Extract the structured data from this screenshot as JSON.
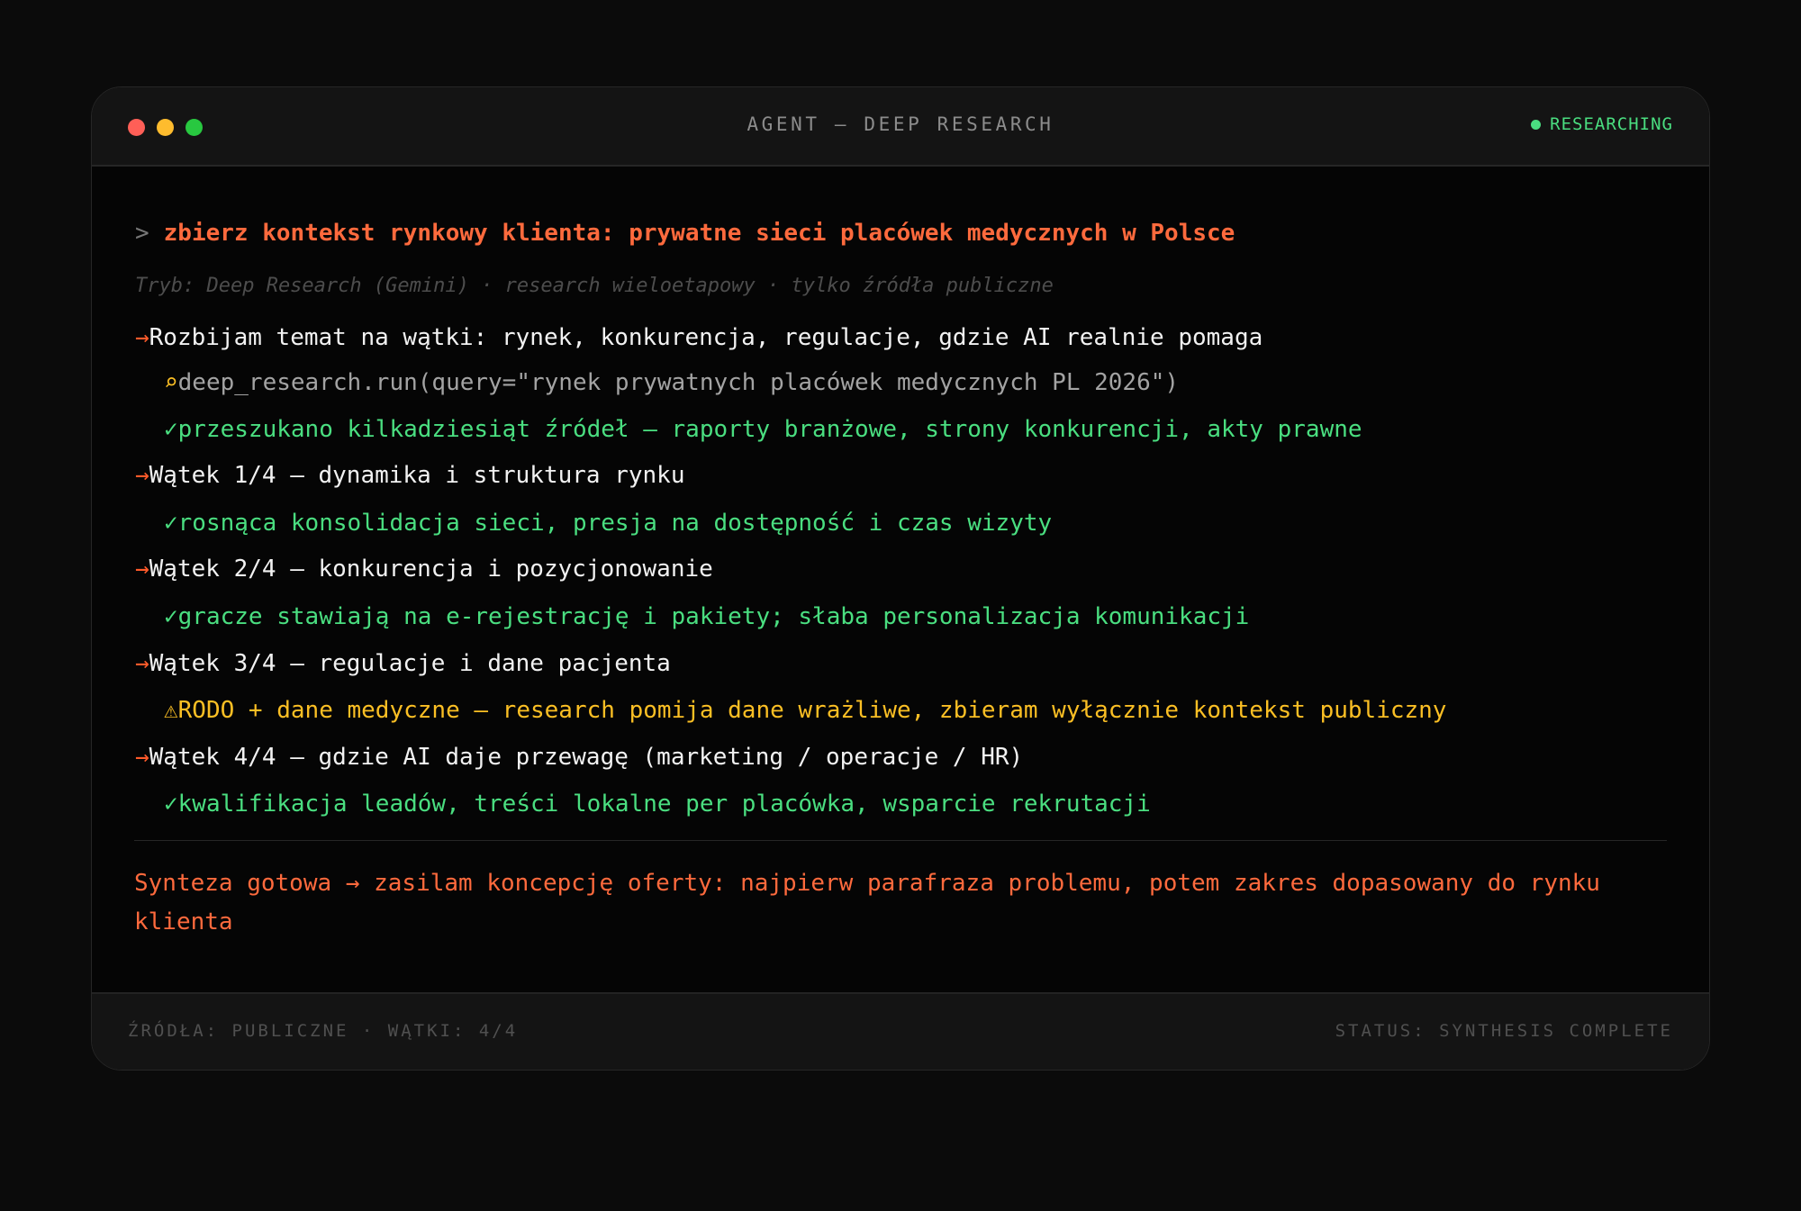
{
  "window": {
    "title": "AGENT — DEEP RESEARCH",
    "status": "RESEARCHING"
  },
  "prompt": {
    "caret": ">",
    "text": "zbierz kontekst rynkowy klienta: prywatne sieci placówek medycznych w Polsce"
  },
  "mode_line": "Tryb: Deep Research (Gemini) · research wieloetapowy · tylko źródła publiczne",
  "log": [
    {
      "kind": "step",
      "icon": "→",
      "text": "Rozbijam temat na wątki: rynek, konkurencja, regulacje, gdzie AI realnie pomaga"
    },
    {
      "kind": "tool",
      "icon": "⌕",
      "text": "deep_research.run(query=\"rynek prywatnych placówek medycznych PL 2026\")"
    },
    {
      "kind": "ok",
      "icon": "✓",
      "text": "przeszukano kilkadziesiąt źródeł — raporty branżowe, strony konkurencji, akty prawne"
    },
    {
      "kind": "step",
      "icon": "→",
      "text": "Wątek 1/4 — dynamika i struktura rynku"
    },
    {
      "kind": "ok",
      "icon": "✓",
      "text": "rosnąca konsolidacja sieci, presja na dostępność i czas wizyty"
    },
    {
      "kind": "step",
      "icon": "→",
      "text": "Wątek 2/4 — konkurencja i pozycjonowanie"
    },
    {
      "kind": "ok",
      "icon": "✓",
      "text": "gracze stawiają na e-rejestrację i pakiety; słaba personalizacja komunikacji"
    },
    {
      "kind": "step",
      "icon": "→",
      "text": "Wątek 3/4 — regulacje i dane pacjenta"
    },
    {
      "kind": "warn",
      "icon": "⚠",
      "text": "RODO + dane medyczne — research pomija dane wrażliwe, zbieram wyłącznie kontekst publiczny"
    },
    {
      "kind": "step",
      "icon": "→",
      "text": "Wątek 4/4 — gdzie AI daje przewagę (marketing / operacje / HR)"
    },
    {
      "kind": "ok",
      "icon": "✓",
      "text": "kwalifikacja leadów, treści lokalne per placówka, wsparcie rekrutacji"
    }
  ],
  "synthesis": "Synteza gotowa → zasilam koncepcję oferty: najpierw parafraza problemu, potem zakres dopasowany do rynku klienta",
  "footer": {
    "left": "ŹRÓDŁA: PUBLICZNE · WĄTKI: 4/4",
    "right": "STATUS: SYNTHESIS COMPLETE"
  },
  "colors": {
    "accent": "#ff6a3d",
    "success": "#4ade80",
    "warning": "#fbbf24",
    "background": "#050505"
  }
}
